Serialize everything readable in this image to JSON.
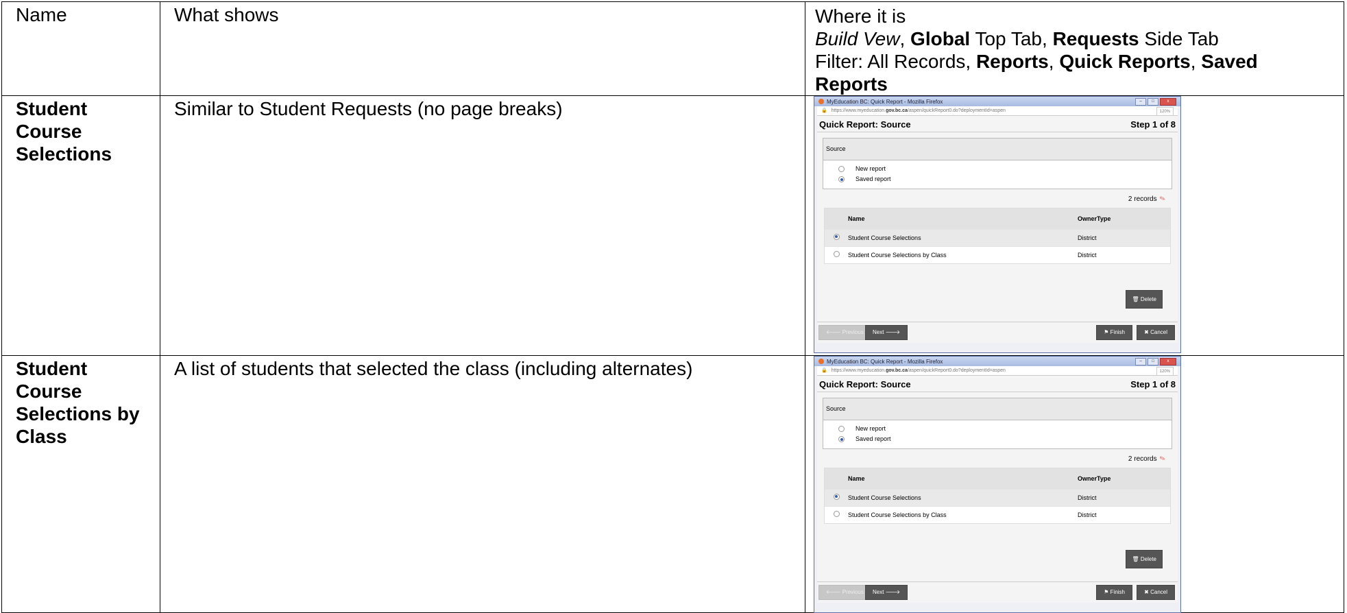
{
  "table": {
    "header": {
      "name": "Name",
      "what": "What shows",
      "where_line1": "Where it is",
      "where_build": "Build Vew",
      "where_global": "Global",
      "where_toptab": " Top Tab, ",
      "where_requests": "Requests",
      "where_sidetab": " Side Tab",
      "where_filter": "Filter: All Records, ",
      "where_reports": "Reports",
      "where_quick": "Quick Reports",
      "where_saved": "Saved Reports"
    },
    "rows": [
      {
        "name": "Student Course Selections",
        "what": "Similar to Student Requests (no page breaks)"
      },
      {
        "name": "Student Course Selections by Class",
        "what": "A list of students that selected the class (including alternates)"
      }
    ]
  },
  "screenshot": {
    "window_title": "MyEducation BC: Quick Report - Mozilla Firefox",
    "url_prefix": "https://www.myeducation.",
    "url_domain": "gov.bc.ca",
    "url_suffix": "/aspen/quickReport0.do?deploymentId=aspen",
    "zoom": "120%",
    "heading": "Quick Report: Source",
    "step": "Step 1 of 8",
    "source_label": "Source",
    "option_new": "New report",
    "option_saved": "Saved report",
    "records": "2 records",
    "col_name": "Name",
    "col_owner": "OwnerType",
    "grid_rows": [
      {
        "name": "Student Course Selections",
        "owner": "District"
      },
      {
        "name": "Student Course Selections by Class",
        "owner": "District"
      }
    ],
    "delete": "Delete",
    "previous": "Previous",
    "next": "Next",
    "finish": "Finish",
    "cancel": "Cancel"
  }
}
